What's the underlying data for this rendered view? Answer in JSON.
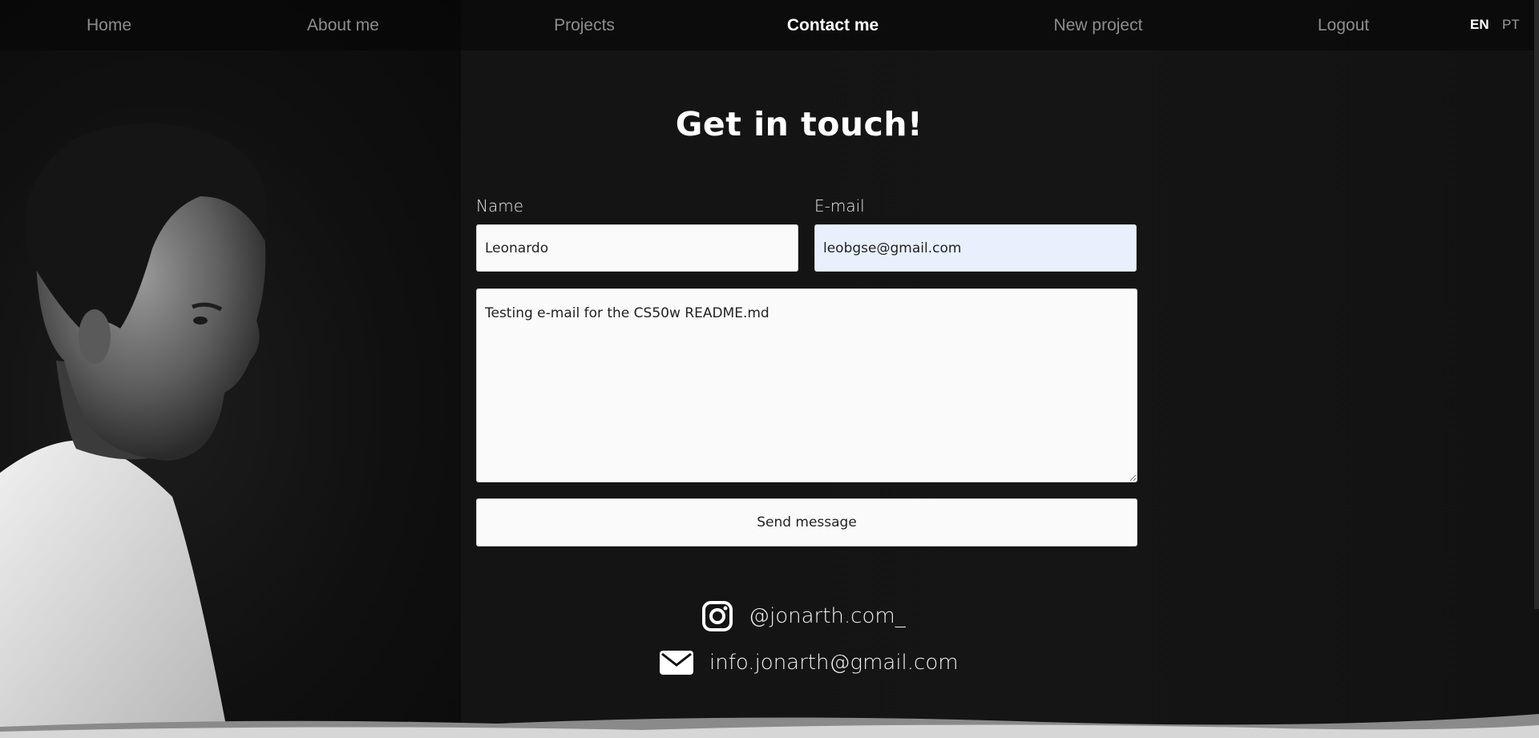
{
  "nav": {
    "items": [
      {
        "label": "Home"
      },
      {
        "label": "About me"
      },
      {
        "label": "Projects"
      },
      {
        "label": "Contact me"
      },
      {
        "label": "New project"
      },
      {
        "label": "Logout"
      }
    ],
    "lang_en": "EN",
    "lang_pt": "PT"
  },
  "heading": "Get in touch!",
  "form": {
    "name_label": "Name",
    "name_value": "Leonardo",
    "email_label": "E-mail",
    "email_value": "leobgse@gmail.com",
    "message_value": "Testing e-mail for the CS50w README.md",
    "send_label": "Send message"
  },
  "contacts": {
    "instagram": "@jonarth.com_",
    "email": "info.jonarth@gmail.com"
  },
  "icons": {
    "instagram": "instagram-icon",
    "email": "envelope-icon"
  },
  "colors": {
    "background": "#111111",
    "email_autofill": "#e8f0fe"
  }
}
